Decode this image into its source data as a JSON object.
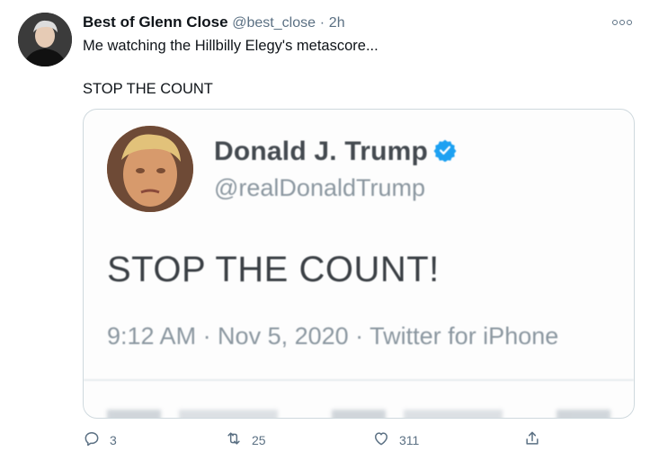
{
  "tweet": {
    "display_name": "Best of Glenn Close",
    "handle": "@best_close",
    "separator": "·",
    "timestamp": "2h",
    "line1": "Me watching the Hillbilly Elegy's metascore...",
    "line2": "STOP THE COUNT"
  },
  "embedded": {
    "display_name": "Donald J. Trump",
    "handle": "@realDonaldTrump",
    "text": "STOP THE COUNT!",
    "meta": "9:12 AM · Nov 5, 2020 · Twitter for iPhone"
  },
  "actions": {
    "reply_count": "3",
    "retweet_count": "25",
    "like_count": "311"
  },
  "colors": {
    "secondary_text": "#5b7083",
    "verified_blue": "#1da1f2",
    "border": "#cfd9de"
  },
  "icons": [
    "more-icon",
    "verified-badge-icon",
    "reply-icon",
    "retweet-icon",
    "like-icon",
    "share-icon"
  ]
}
